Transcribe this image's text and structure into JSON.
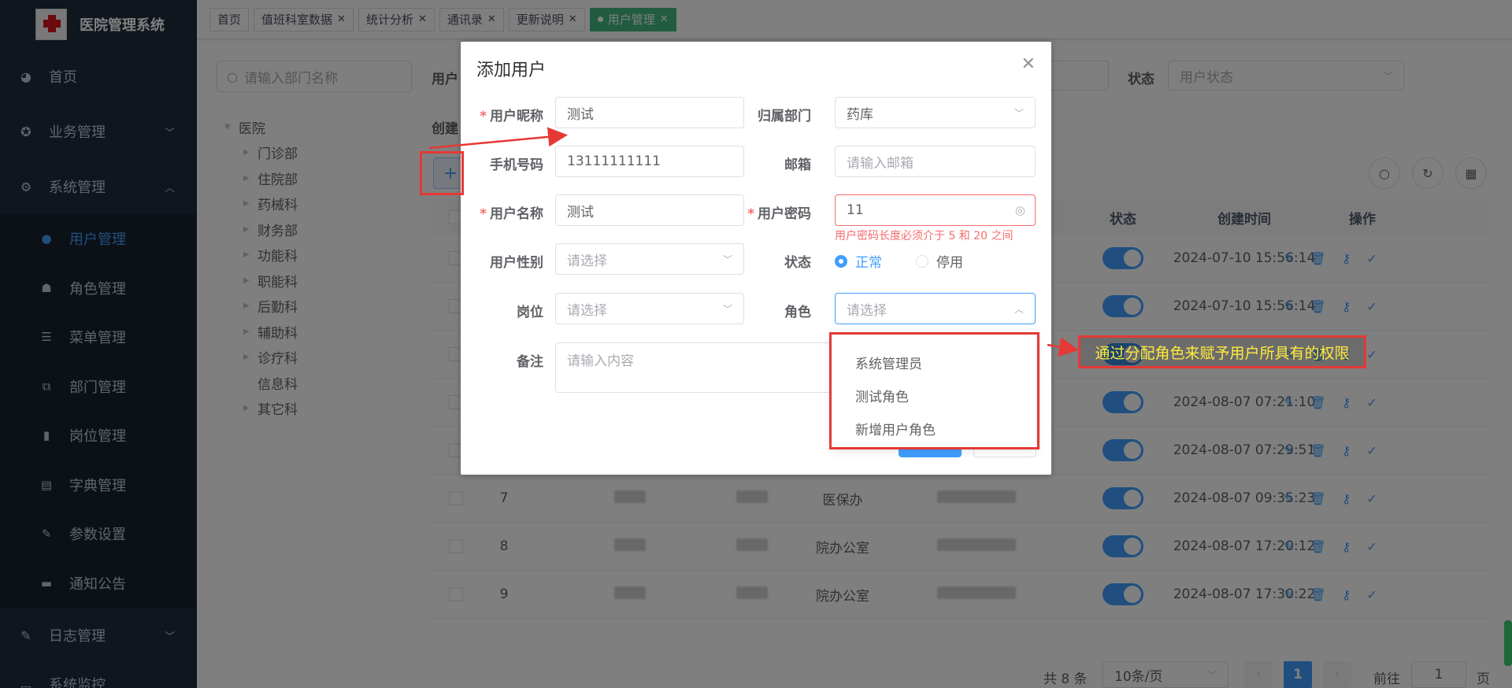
{
  "app": {
    "title": "医院管理系统"
  },
  "sidebar": {
    "top_items": [
      {
        "label": "首页",
        "icon": "dashboard-icon"
      },
      {
        "label": "业务管理",
        "icon": "business-icon"
      },
      {
        "label": "系统管理",
        "icon": "gear-icon"
      }
    ],
    "sub_items": [
      {
        "label": "用户管理",
        "icon": "user-icon",
        "active": true
      },
      {
        "label": "角色管理",
        "icon": "role-icon"
      },
      {
        "label": "菜单管理",
        "icon": "menu-icon"
      },
      {
        "label": "部门管理",
        "icon": "tree-icon"
      },
      {
        "label": "岗位管理",
        "icon": "post-icon"
      },
      {
        "label": "字典管理",
        "icon": "dict-icon"
      },
      {
        "label": "参数设置",
        "icon": "edit-icon"
      },
      {
        "label": "通知公告",
        "icon": "message-icon"
      }
    ],
    "log_item": {
      "label": "日志管理",
      "icon": "log-icon"
    },
    "bottom_partial": "系统监控"
  },
  "tags": [
    {
      "label": "首页",
      "closable": false
    },
    {
      "label": "值班科室数据",
      "closable": true
    },
    {
      "label": "统计分析",
      "closable": true
    },
    {
      "label": "通讯录",
      "closable": true
    },
    {
      "label": "更新说明",
      "closable": true
    },
    {
      "label": "用户管理",
      "closable": true,
      "active": true
    }
  ],
  "dept_search": {
    "placeholder": "请输入部门名称"
  },
  "tree": {
    "root": "医院",
    "children": [
      "门诊部",
      "住院部",
      "药械科",
      "财务部",
      "功能科",
      "职能科",
      "后勤科",
      "辅助科",
      "诊疗科",
      "信息科",
      "其它科"
    ]
  },
  "query": {
    "user_label_partial": "用户",
    "create_label_partial": "创建",
    "status_label": "状态",
    "status_placeholder": "用户状态"
  },
  "table": {
    "headers": {
      "status": "状态",
      "created": "创建时间",
      "ops": "操作"
    },
    "rows": [
      {
        "id": "",
        "dept": "",
        "created": "2024-07-10 15:56:14"
      },
      {
        "id": "",
        "dept": "",
        "created": "2024-07-10 15:56:14"
      },
      {
        "id": "",
        "dept": "",
        "created": ""
      },
      {
        "id": "",
        "dept": "",
        "created": "2024-08-07 07:21:10"
      },
      {
        "id": "",
        "dept": "",
        "created": "2024-08-07 07:29:51"
      },
      {
        "id": "7",
        "dept": "医保办",
        "created": "2024-08-07 09:35:23"
      },
      {
        "id": "8",
        "dept": "院办公室",
        "created": "2024-08-07 17:20:12"
      },
      {
        "id": "9",
        "dept": "院办公室",
        "created": "2024-08-07 17:30:22"
      }
    ]
  },
  "pager": {
    "total": "共 8 条",
    "size": "10条/页",
    "current": "1",
    "goto": "前往",
    "goto_value": "1",
    "page": "页"
  },
  "dialog": {
    "title": "添加用户",
    "nickname_label": "用户昵称",
    "nickname_value": "测试",
    "dept_label": "归属部门",
    "dept_value": "药库",
    "phone_label": "手机号码",
    "phone_value": "13111111111",
    "email_label": "邮箱",
    "email_placeholder": "请输入邮箱",
    "username_label": "用户名称",
    "username_value": "测试",
    "password_label": "用户密码",
    "password_value": "11",
    "password_error": "用户密码长度必须介于 5 和 20 之间",
    "gender_label": "用户性别",
    "gender_placeholder": "请选择",
    "status_label": "状态",
    "status_normal": "正常",
    "status_disabled": "停用",
    "post_label": "岗位",
    "post_placeholder": "请选择",
    "role_label": "角色",
    "role_placeholder": "请选择",
    "remark_label": "备注",
    "remark_placeholder": "请输入内容"
  },
  "role_options": [
    "系统管理员",
    "测试角色",
    "新增用户角色"
  ],
  "annotation": {
    "callout": "通过分配角色来赋予用户所具有的权限"
  },
  "colors": {
    "primary": "#409eff",
    "sidebar": "#1f2d3d",
    "danger": "#f56c6c",
    "annotation": "#e53935",
    "callout_text": "#ffeb3b"
  }
}
